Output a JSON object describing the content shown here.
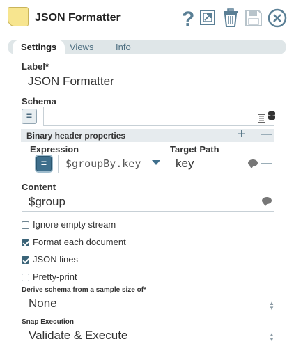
{
  "header": {
    "title": "JSON Formatter",
    "icons": [
      "help-icon",
      "export-icon",
      "delete-icon",
      "save-icon",
      "close-icon"
    ]
  },
  "tabs": [
    {
      "label": "Settings",
      "active": true
    },
    {
      "label": "Views",
      "active": false
    },
    {
      "label": "Info",
      "active": false
    }
  ],
  "label_field": {
    "label": "Label*",
    "value": "JSON Formatter"
  },
  "schema_field": {
    "label": "Schema",
    "value": ""
  },
  "binary_header": {
    "title": "Binary header properties",
    "add_label": "+",
    "remove_label": "—",
    "expression_label": "Expression",
    "target_path_label": "Target Path",
    "expression_value": "$groupBy.key",
    "target_path_value": "key",
    "row_remove_label": "—"
  },
  "content_field": {
    "label": "Content",
    "value": "$group"
  },
  "checkboxes": [
    {
      "label": "Ignore empty stream",
      "checked": false
    },
    {
      "label": "Format each document",
      "checked": true
    },
    {
      "label": "JSON lines",
      "checked": true
    },
    {
      "label": "Pretty-print",
      "checked": false
    }
  ],
  "sample_size": {
    "label": "Derive schema from a sample size of*",
    "value": "None"
  },
  "snap_execution": {
    "label": "Snap Execution",
    "value": "Validate & Execute"
  },
  "eq_symbol": "=",
  "colors": {
    "accent": "#3f6f8c",
    "tab_bar": "#dfe6e8",
    "icon": "#5a7f95",
    "title_icon": "#f7e58f"
  }
}
